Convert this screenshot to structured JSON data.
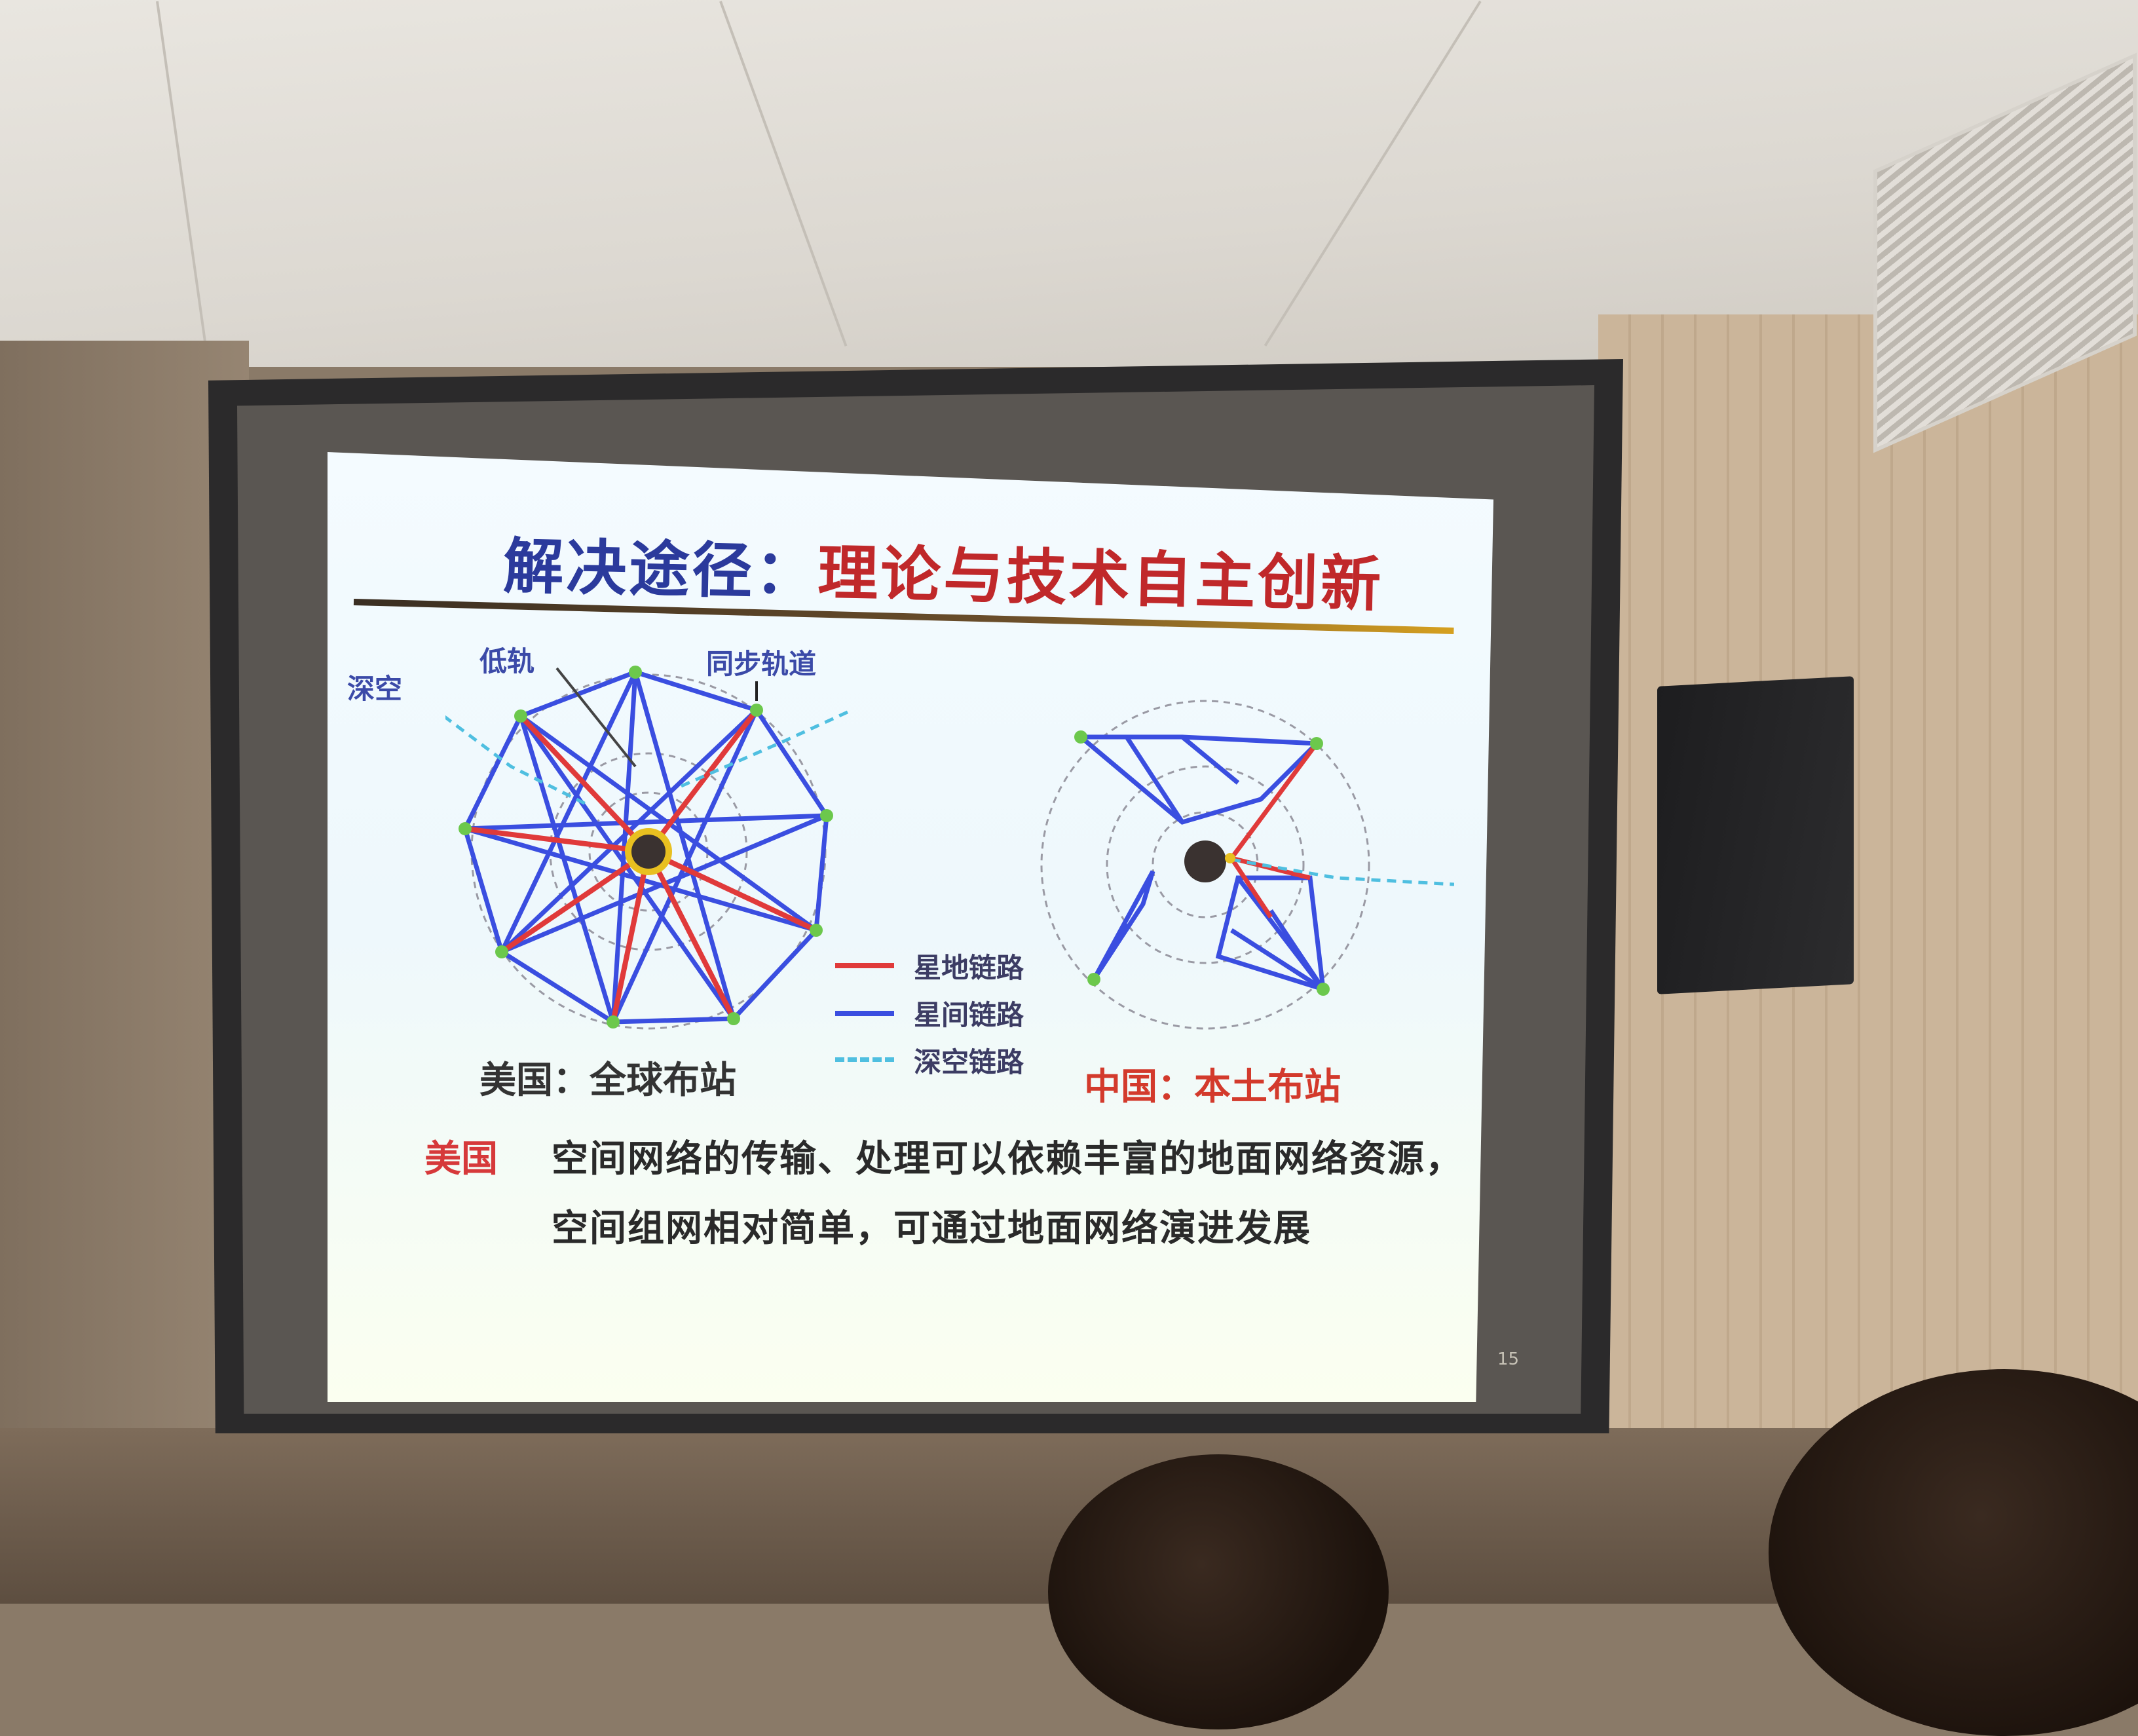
{
  "slide": {
    "title_part1": "解决途径：",
    "title_part2": "理论与技术自主创新",
    "labels": {
      "deep_space": "深空",
      "low_orbit": "低轨",
      "geo_orbit": "同步轨道"
    },
    "legend": [
      {
        "label": "星地链路",
        "color": "#e03a3a",
        "style": "solid"
      },
      {
        "label": "星间链路",
        "color": "#3a4ee0",
        "style": "solid"
      },
      {
        "label": "深空链路",
        "color": "#4fbfe0",
        "style": "dashed"
      }
    ],
    "caption_us": "美国：全球布站",
    "caption_cn": "中国：本土布站",
    "body_prefix": "美国",
    "body_line1": "空间网络的传输、处理可以依赖丰富的地面网络资源，",
    "body_line2": "空间组网相对简单，可通过地面网络演进发展",
    "page_number": "15"
  },
  "colors": {
    "ground_link": "#e03a3a",
    "inter_sat_link": "#3a4ee0",
    "deep_space_link": "#4fbfe0",
    "node": "#6cc84c"
  }
}
